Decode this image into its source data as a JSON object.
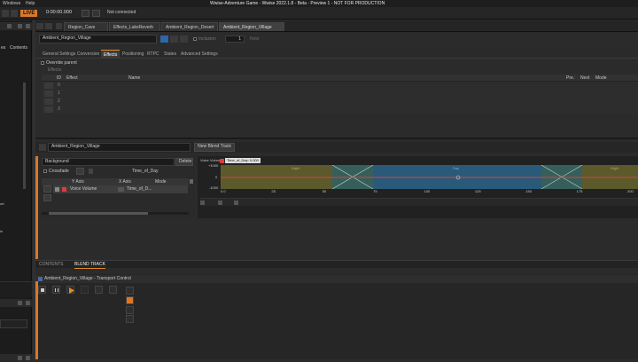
{
  "titlebar": {
    "menus": [
      "Windows",
      "Help"
    ],
    "title": "Wwise-Adventure Game - Wwise 2022.1.8 - Beta - Preview 1 - NOT FOR PRODUCTION"
  },
  "toolbar": {
    "live": "LIVE",
    "timecode": "0:00:00.000",
    "connection": "Not connected"
  },
  "left": {
    "label_sfx": "es",
    "label_contents": "Contents",
    "frag1": "ort",
    "frag2": "in"
  },
  "tabs": [
    {
      "label": "Region_Cave"
    },
    {
      "label": "Effects_LakeReverb"
    },
    {
      "label": "Ambient_Region_Desert"
    },
    {
      "label": "Ambient_Region_Village"
    }
  ],
  "object": {
    "name": "Ambient_Region_Village",
    "inclusion": "Inclusion",
    "count": "1",
    "note": "Note"
  },
  "prop_tabs": [
    "General Settings",
    "Conversion",
    "Effects",
    "Positioning",
    "RTPC",
    "States",
    "Advanced Settings"
  ],
  "effects": {
    "override": "Override parent",
    "effects_label": "Effects",
    "headers": {
      "id": "ID",
      "effect": "Effect",
      "name": "Name",
      "pre": "Pre.",
      "next": "Next",
      "mode": "Mode"
    },
    "rows": [
      "0",
      "1",
      "2",
      "3"
    ]
  },
  "blend": {
    "container": "Ambient_Region_Village",
    "new_track": "New Blend Track",
    "track_name": "Background",
    "delete": "Delete",
    "crossfade": "Crossfade",
    "param": "Time_of_Day",
    "col_yaxis": "Y Axis",
    "col_xaxis": "X Axis",
    "col_mode": "Mode",
    "row_y": "Voice Volume",
    "row_x": "Time_of_D...",
    "vol_label": "Voice Volume",
    "tip": "Time_of_Day: 0.000",
    "y_ticks": [
      "+1000",
      "0",
      "-1000"
    ],
    "x_ticks": [
      "0.0",
      "25",
      "50",
      "75",
      "100",
      "125",
      "150",
      "175",
      "200"
    ],
    "zones": [
      "Night",
      "Day",
      "Night"
    ]
  },
  "bottom_tabs": [
    "CONTENTS",
    "BLEND TRACK"
  ],
  "transport": {
    "title": "Ambient_Region_Village - Transport Control"
  },
  "colors": {
    "accent": "#e28a2c",
    "night": "#5c5a2a",
    "day": "#2a5a7a",
    "curve": "#d84040",
    "swatch": "#e03a3a"
  }
}
